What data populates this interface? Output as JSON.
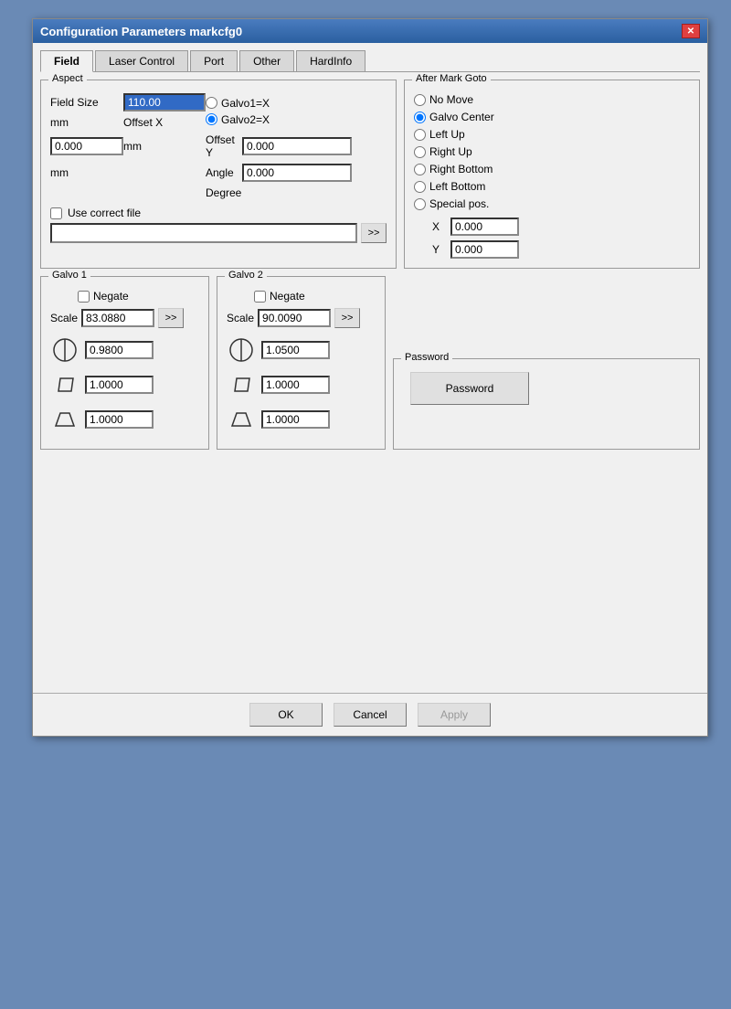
{
  "window": {
    "title": "Configuration Parameters markcfg0",
    "close_label": "✕"
  },
  "tabs": [
    {
      "id": "field",
      "label": "Field",
      "active": true
    },
    {
      "id": "laser-control",
      "label": "Laser Control",
      "active": false
    },
    {
      "id": "port",
      "label": "Port",
      "active": false
    },
    {
      "id": "other",
      "label": "Other",
      "active": false
    },
    {
      "id": "hardinfo",
      "label": "HardInfo",
      "active": false
    }
  ],
  "aspect": {
    "legend": "Aspect",
    "field_size_label": "Field Size",
    "field_size_value": "110.00",
    "field_size_unit": "mm",
    "offset_x_label": "Offset X",
    "offset_x_value": "0.000",
    "offset_x_unit": "mm",
    "offset_y_label": "Offset Y",
    "offset_y_value": "0.000",
    "offset_y_unit": "mm",
    "angle_label": "Angle",
    "angle_value": "0.000",
    "angle_unit": "Degree",
    "galvo1_label": "Galvo1=X",
    "galvo2_label": "Galvo2=X",
    "use_correct_file_label": "Use correct file",
    "browse_label": ">>"
  },
  "after_mark_goto": {
    "legend": "After Mark Goto",
    "options": [
      {
        "id": "no-move",
        "label": "No Move",
        "checked": false
      },
      {
        "id": "galvo-center",
        "label": "Galvo Center",
        "checked": true
      },
      {
        "id": "left-up",
        "label": "Left Up",
        "checked": false
      },
      {
        "id": "right-up",
        "label": "Right Up",
        "checked": false
      },
      {
        "id": "right-bottom",
        "label": "Right Bottom",
        "checked": false
      },
      {
        "id": "left-bottom",
        "label": "Left Bottom",
        "checked": false
      },
      {
        "id": "special-pos",
        "label": "Special pos.",
        "checked": false
      }
    ],
    "x_label": "X",
    "x_value": "0.000",
    "y_label": "Y",
    "y_value": "0.000"
  },
  "galvo1": {
    "legend": "Galvo 1",
    "negate_label": "Negate",
    "scale_label": "Scale",
    "scale_value": "83.0880",
    "browse_label": ">>",
    "val1": "0.9800",
    "val2": "1.0000",
    "val3": "1.0000"
  },
  "galvo2": {
    "legend": "Galvo 2",
    "negate_label": "Negate",
    "scale_label": "Scale",
    "scale_value": "90.0090",
    "browse_label": ">>",
    "val1": "1.0500",
    "val2": "1.0000",
    "val3": "1.0000"
  },
  "password": {
    "legend": "Password",
    "button_label": "Password"
  },
  "buttons": {
    "ok_label": "OK",
    "cancel_label": "Cancel",
    "apply_label": "Apply"
  }
}
